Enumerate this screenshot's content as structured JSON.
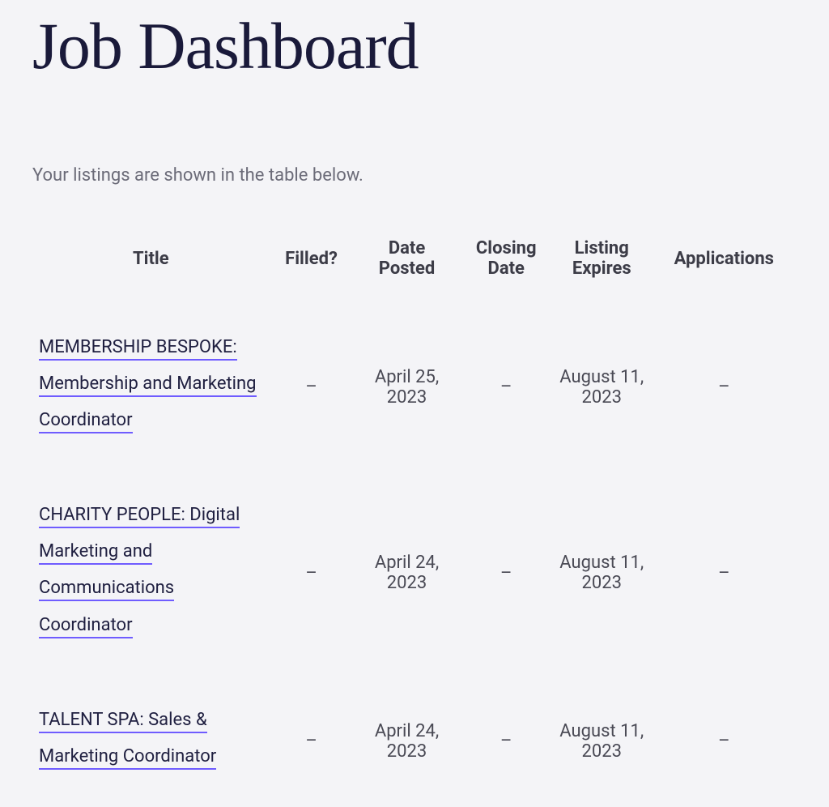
{
  "header": {
    "title": "Job Dashboard",
    "intro": "Your listings are shown in the table below."
  },
  "table": {
    "columns": {
      "title": "Title",
      "filled": "Filled?",
      "date_posted": "Date Posted",
      "closing_date": "Closing Date",
      "listing_expires": "Listing Expires",
      "applications": "Applications"
    },
    "rows": [
      {
        "title": "MEMBERSHIP BESPOKE: Membership and Marketing Coordinator",
        "filled": "–",
        "date_posted": "April 25, 2023",
        "closing_date": "–",
        "listing_expires": "August 11, 2023",
        "applications": "–"
      },
      {
        "title": "CHARITY PEOPLE: Digital Marketing and Communications Coordinator",
        "filled": "–",
        "date_posted": "April 24, 2023",
        "closing_date": "–",
        "listing_expires": "August 11, 2023",
        "applications": "–"
      },
      {
        "title": "TALENT SPA: Sales & Marketing Coordinator",
        "filled": "–",
        "date_posted": "April 24, 2023",
        "closing_date": "–",
        "listing_expires": "August 11, 2023",
        "applications": "–"
      }
    ]
  }
}
